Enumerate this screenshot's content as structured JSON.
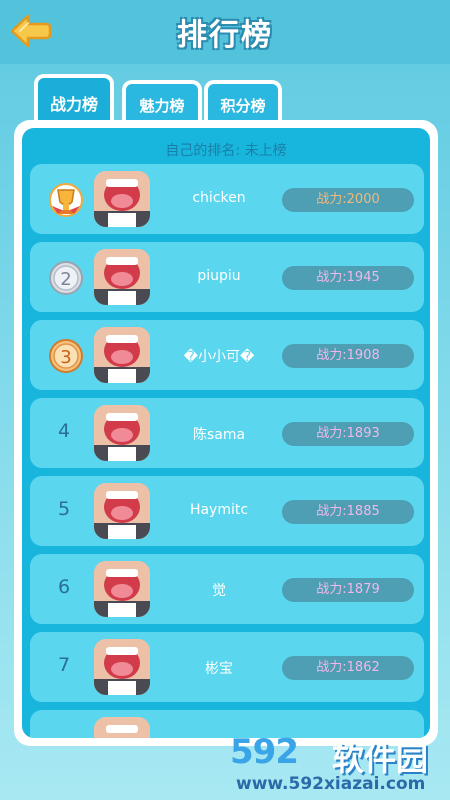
{
  "header": {
    "title": "排行榜",
    "back_icon": "arrow-left-icon"
  },
  "tabs": [
    {
      "label": "战力榜",
      "active": true
    },
    {
      "label": "魅力榜",
      "active": false
    },
    {
      "label": "积分榜",
      "active": false
    }
  ],
  "my_rank": "自己的排名: 未上榜",
  "rows": [
    {
      "rank": "1",
      "name": "chicken",
      "power": "战力:2000",
      "medal": "gold-trophy-icon"
    },
    {
      "rank": "2",
      "name": "piupiu",
      "power": "战力:1945",
      "medal": "silver-medal-icon"
    },
    {
      "rank": "3",
      "name": "�小小可�",
      "power": "战力:1908",
      "medal": "bronze-medal-icon"
    },
    {
      "rank": "4",
      "name": "陈sama",
      "power": "战力:1893"
    },
    {
      "rank": "5",
      "name": "Haymitc",
      "power": "战力:1885"
    },
    {
      "rank": "6",
      "name": "觉",
      "power": "战力:1879"
    },
    {
      "rank": "7",
      "name": "彬宝",
      "power": "战力:1862"
    }
  ],
  "watermark": {
    "number": "592",
    "text": "软件园",
    "url": "www.592xiazai.com"
  },
  "colors": {
    "background": "#5ec9e0",
    "panel": "#18b5dc",
    "row": "#5ad6ef",
    "power_pill": "#4e9fb3",
    "power_gold": "#f1b87c",
    "power_pink": "#f1b8ea"
  }
}
